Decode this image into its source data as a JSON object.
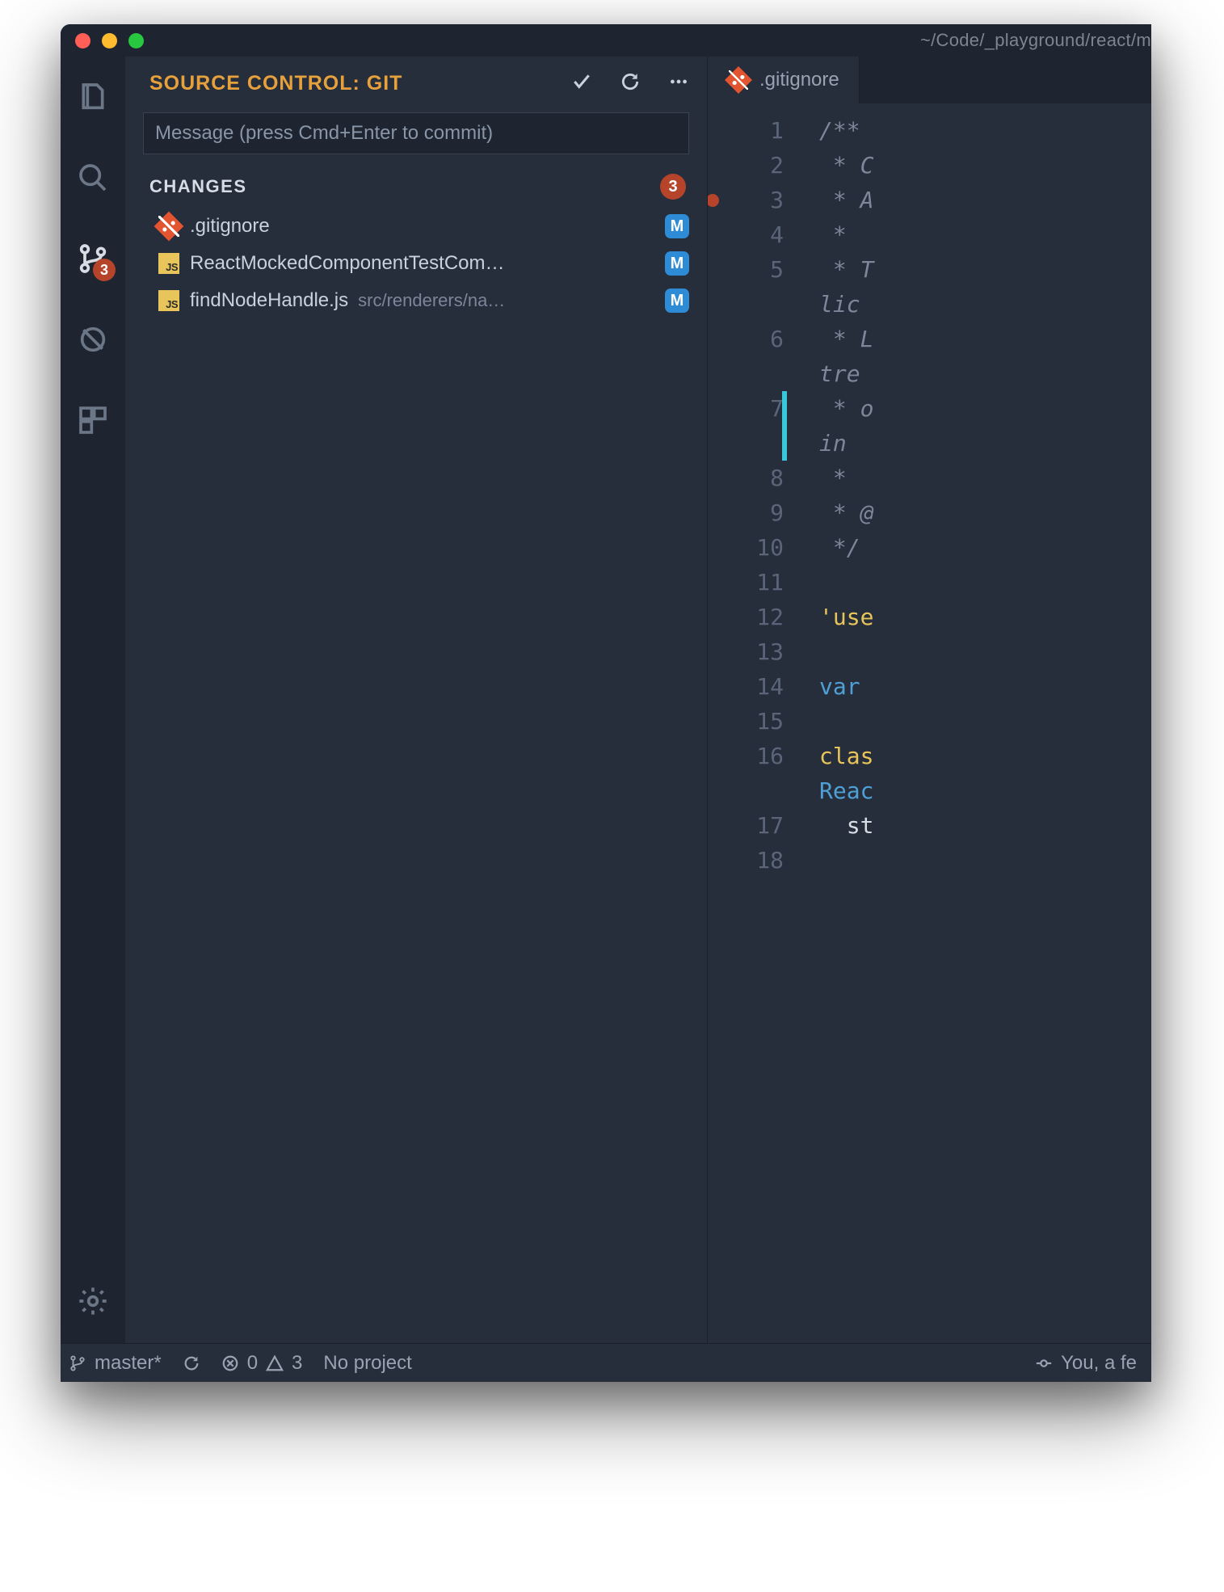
{
  "window": {
    "title_path": "~/Code/_playground/react/m"
  },
  "activity": {
    "items": [
      {
        "name": "explorer",
        "icon": "files-icon"
      },
      {
        "name": "search",
        "icon": "search-icon"
      },
      {
        "name": "scm",
        "icon": "branch-icon",
        "active": true,
        "badge": "3"
      },
      {
        "name": "debug",
        "icon": "bug-icon"
      },
      {
        "name": "extensions",
        "icon": "extensions-icon"
      }
    ],
    "bottom": {
      "name": "settings",
      "icon": "gear-icon"
    }
  },
  "scm": {
    "title": "SOURCE CONTROL: GIT",
    "actions": {
      "commit": "commit-check-icon",
      "refresh": "refresh-icon",
      "more": "more-icon"
    },
    "message_placeholder": "Message (press Cmd+Enter to commit)",
    "section_label": "CHANGES",
    "change_count": "3",
    "changes": [
      {
        "icon": "git",
        "name": ".gitignore",
        "path": "",
        "status": "M"
      },
      {
        "icon": "js",
        "name": "ReactMockedComponentTestCom…",
        "path": "",
        "status": "M"
      },
      {
        "icon": "js",
        "name": "findNodeHandle.js",
        "path": "src/renderers/na…",
        "status": "M"
      }
    ]
  },
  "editor": {
    "tab": {
      "icon": "git",
      "label": ".gitignore"
    },
    "gutter": [
      {
        "n": "1"
      },
      {
        "n": "2"
      },
      {
        "n": "3",
        "dot": true
      },
      {
        "n": "4"
      },
      {
        "n": "5",
        "tall": true
      },
      {
        "n": "6",
        "tall": true
      },
      {
        "n": "7",
        "tall": true,
        "bar": true
      },
      {
        "n": "8"
      },
      {
        "n": "9"
      },
      {
        "n": "10"
      },
      {
        "n": "11"
      },
      {
        "n": "12"
      },
      {
        "n": "13"
      },
      {
        "n": "14"
      },
      {
        "n": "15"
      },
      {
        "n": "16",
        "tall": true
      },
      {
        "n": "17"
      },
      {
        "n": "18"
      }
    ],
    "lines": [
      {
        "html": "<span class='tok-com'>/**</span>"
      },
      {
        "html": "<span class='tok-com'> * C</span>"
      },
      {
        "html": "<span class='tok-com'> * A</span>"
      },
      {
        "html": "<span class='tok-com'> *</span>"
      },
      {
        "html": "<span class='tok-com'> * T</span><br><span class='tok-com'>lic</span>",
        "tall": true
      },
      {
        "html": "<span class='tok-com'> * L</span><br><span class='tok-com'>tre</span>",
        "tall": true
      },
      {
        "html": "<span class='tok-com'> * o</span><br><span class='tok-com'>in </span>",
        "tall": true
      },
      {
        "html": "<span class='tok-com'> *</span>"
      },
      {
        "html": "<span class='tok-com'> * @</span>"
      },
      {
        "html": "<span class='tok-com'> */</span>"
      },
      {
        "html": ""
      },
      {
        "html": "<span class='tok-str'>'use</span>"
      },
      {
        "html": ""
      },
      {
        "html": "<span class='tok-kw'>var</span> "
      },
      {
        "html": ""
      },
      {
        "html": "<span class='tok-cls'>clas</span><br><span class='tok-type'>Reac</span>",
        "tall": true
      },
      {
        "html": "  <span class='tok-id'>st</span>"
      },
      {
        "html": ""
      }
    ]
  },
  "status": {
    "branch": "master*",
    "errors": "0",
    "warnings": "3",
    "project": "No project",
    "blame": "You, a fe"
  }
}
